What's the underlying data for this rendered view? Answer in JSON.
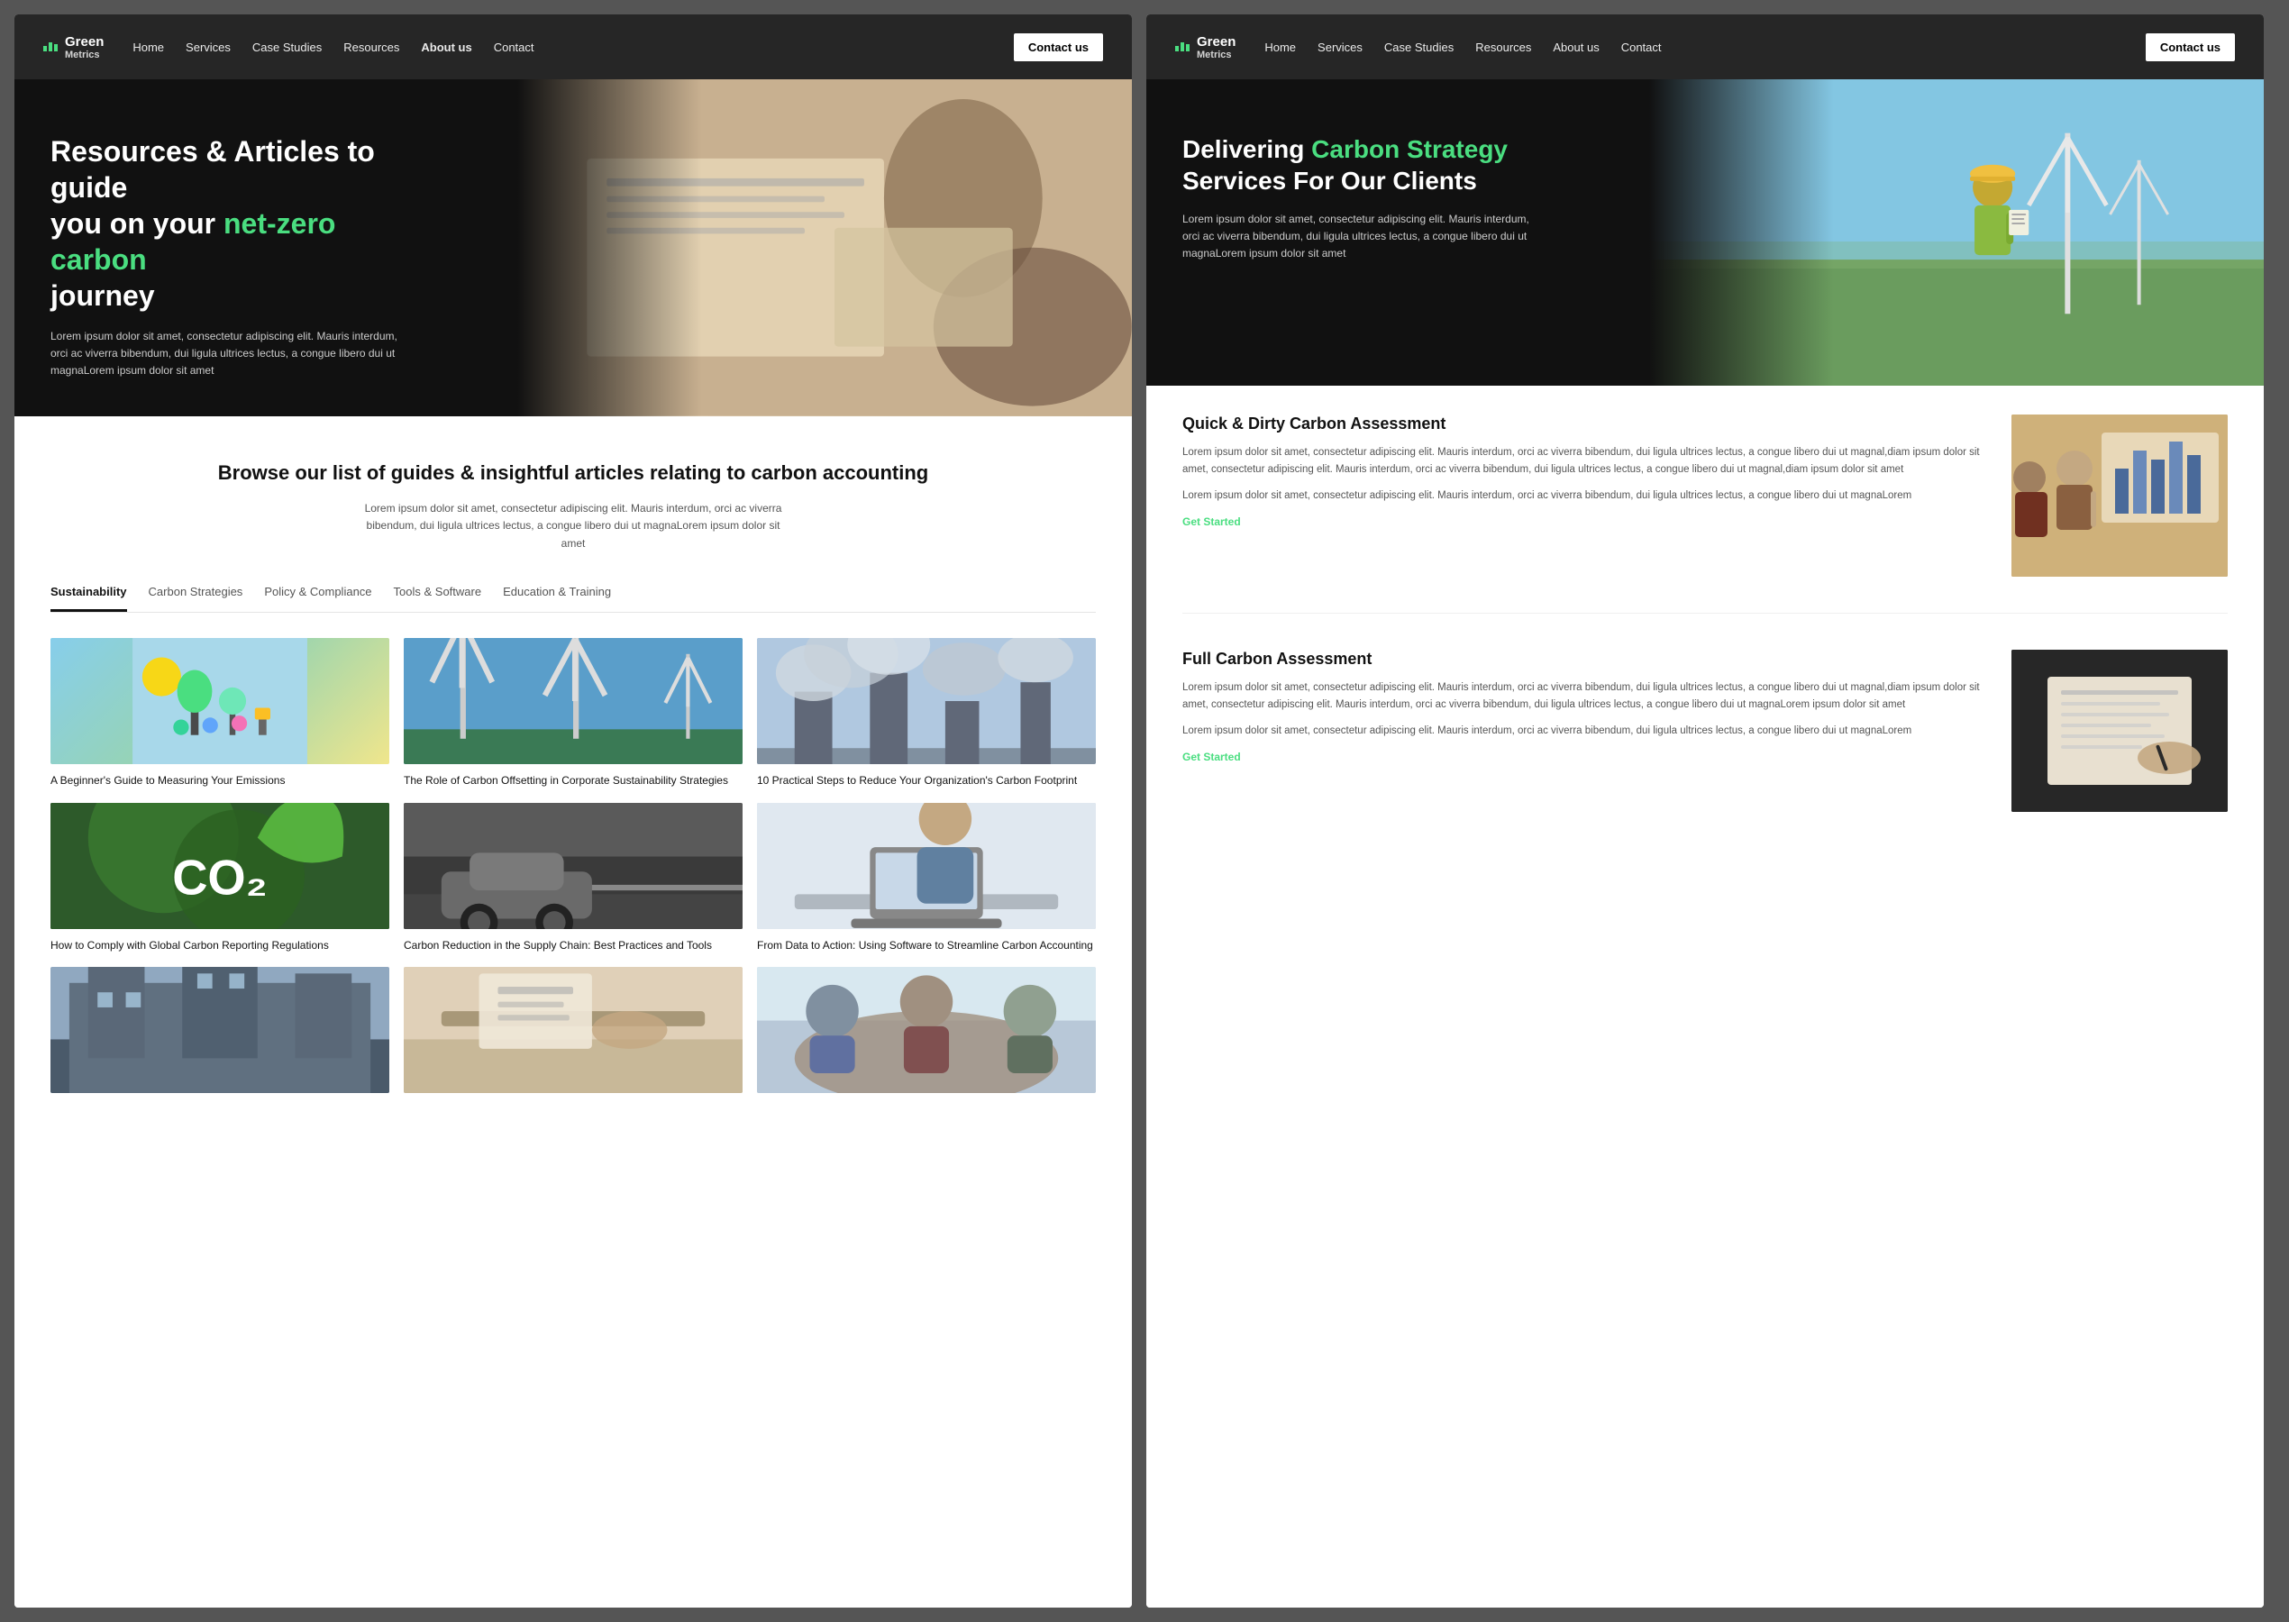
{
  "panels": [
    {
      "id": "left",
      "navbar": {
        "logo_name": "Green",
        "logo_name2": "Metrics",
        "nav_links": [
          {
            "label": "Home",
            "active": false
          },
          {
            "label": "Services",
            "active": false
          },
          {
            "label": "Case Studies",
            "active": false
          },
          {
            "label": "Resources",
            "active": false
          },
          {
            "label": "About us",
            "active": true
          },
          {
            "label": "Contact",
            "active": false
          }
        ],
        "contact_btn": "Contact us"
      },
      "hero": {
        "heading_line1": "Resources & Articles to guide",
        "heading_line2": "you on your ",
        "heading_green": "net-zero carbon",
        "heading_line3": "journey",
        "body": "Lorem ipsum dolor sit amet, consectetur adipiscing elit. Mauris  interdum, orci ac viverra bibendum, dui ligula ultrices lectus, a congue  libero dui ut magnaLorem ipsum dolor sit amet"
      },
      "browse": {
        "heading": "Browse our list of guides & insightful articles relating to carbon accounting",
        "body": "Lorem ipsum dolor sit amet, consectetur adipiscing elit. Mauris  interdum, orci ac viverra bibendum, dui ligula ultrices lectus, a congue  libero dui ut magnaLorem ipsum dolor sit amet"
      },
      "tabs": [
        {
          "label": "Sustainability",
          "active": true
        },
        {
          "label": "Carbon Strategies",
          "active": false
        },
        {
          "label": "Policy & Compliance",
          "active": false
        },
        {
          "label": "Tools & Software",
          "active": false
        },
        {
          "label": "Education & Training",
          "active": false
        }
      ],
      "articles": [
        {
          "title": "A Beginner's Guide to Measuring Your Emissions",
          "thumb_type": "sustainability"
        },
        {
          "title": "The Role of Carbon Offsetting in Corporate Sustainability Strategies",
          "thumb_type": "energy"
        },
        {
          "title": "10 Practical Steps to Reduce Your Organization's Carbon Footprint",
          "thumb_type": "smoke"
        },
        {
          "title": "How to Comply with Global Carbon Reporting Regulations",
          "thumb_type": "co2"
        },
        {
          "title": "Carbon Reduction in the Supply Chain: Best Practices and Tools",
          "thumb_type": "car"
        },
        {
          "title": "From Data to Action: Using Software to Streamline Carbon Accounting",
          "thumb_type": "laptop"
        },
        {
          "title": "",
          "thumb_type": "factory"
        },
        {
          "title": "",
          "thumb_type": "desk"
        },
        {
          "title": "",
          "thumb_type": "meeting"
        }
      ]
    },
    {
      "id": "right",
      "navbar": {
        "logo_name": "Green",
        "logo_name2": "Metrics",
        "nav_links": [
          {
            "label": "Home",
            "active": false
          },
          {
            "label": "Services",
            "active": false
          },
          {
            "label": "Case Studies",
            "active": false
          },
          {
            "label": "Resources",
            "active": false
          },
          {
            "label": "About us",
            "active": false
          },
          {
            "label": "Contact",
            "active": false
          }
        ],
        "contact_btn": "Contact us"
      },
      "hero": {
        "heading_line1": "Delivering ",
        "heading_green": "Carbon Strategy",
        "heading_line2": "Services For Our Clients",
        "body": "Lorem ipsum dolor sit amet, consectetur adipiscing elit. Mauris  interdum, orci ac viverra bibendum, dui ligula ultrices lectus, a congue  libero dui ut magnaLorem ipsum dolor sit amet"
      },
      "services": [
        {
          "id": "quick",
          "heading": "Quick & Dirty Carbon Assessment",
          "body1": "Lorem ipsum dolor sit amet, consectetur adipiscing elit. Mauris interdum, orci ac viverra bibendum, dui ligula ultrices lectus, a congue libero dui ut magnal,diam ipsum dolor sit amet, consectetur adipiscing elit. Mauris  interdum, orci ac viverra bibendum, dui ligula ultrices lectus, a congue  libero dui ut magnal,diam ipsum dolor sit amet",
          "body2": "Lorem ipsum dolor sit amet, consectetur adipiscing elit. Mauris interdum, orci ac viverra bibendum, dui ligula ultrices lectus, a congue libero dui ut magnaLorem",
          "cta": "Get Started",
          "img_type": "svc-img-1"
        },
        {
          "id": "full",
          "heading": "Full Carbon Assessment",
          "body1": "Lorem ipsum dolor sit amet, consectetur adipiscing elit. Mauris interdum, orci ac viverra bibendum, dui ligula ultrices lectus, a congue libero dui ut magnal,diam ipsum dolor sit amet, consectetur adipiscing elit. Mauris  interdum, orci ac viverra bibendum, dui ligula ultrices lectus, a congue  libero dui ut magnaLorem ipsum dolor sit amet",
          "body2": "Lorem ipsum dolor sit amet, consectetur adipiscing elit. Mauris interdum, orci ac viverra bibendum, dui ligula ultrices lectus, a congue libero dui ut magnaLorem",
          "cta": "Get Started",
          "img_type": "svc-img-2"
        }
      ]
    }
  ]
}
